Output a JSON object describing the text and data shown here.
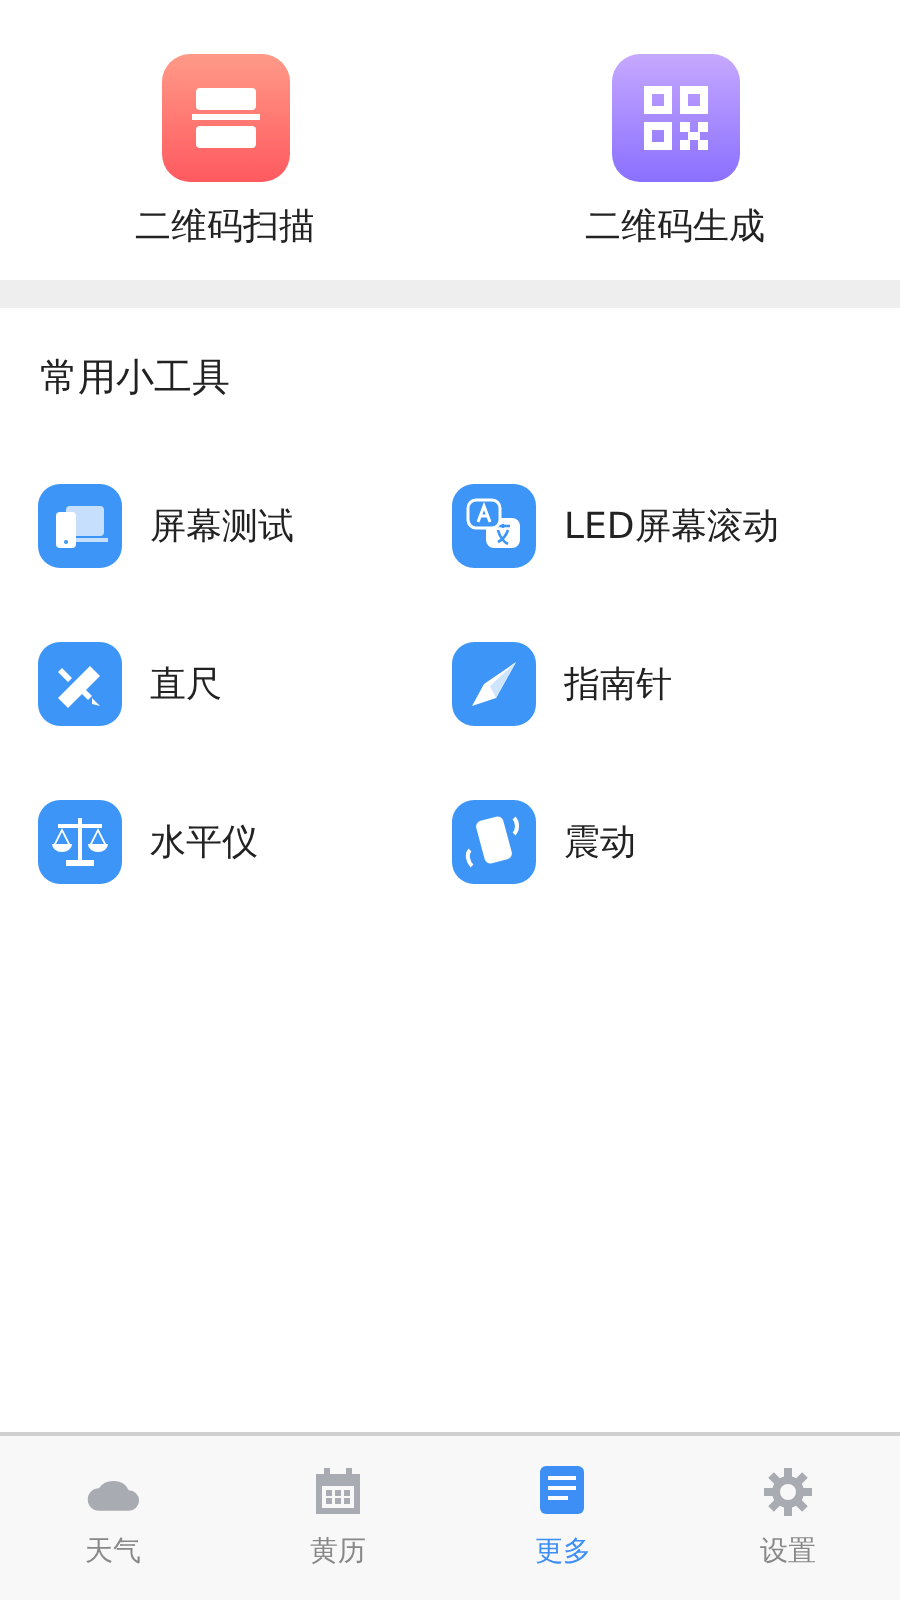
{
  "top_tools": [
    {
      "label": "二维码扫描",
      "kind": "scan"
    },
    {
      "label": "二维码生成",
      "kind": "qr"
    }
  ],
  "section_title": "常用小工具",
  "tools": [
    {
      "label": "屏幕测试",
      "kind": "devices"
    },
    {
      "label": "LED屏幕滚动",
      "kind": "translate"
    },
    {
      "label": "直尺",
      "kind": "ruler"
    },
    {
      "label": "指南针",
      "kind": "compass"
    },
    {
      "label": "水平仪",
      "kind": "scale"
    },
    {
      "label": "震动",
      "kind": "vibrate"
    }
  ],
  "tab_bar": [
    {
      "label": "天气",
      "kind": "cloud",
      "selected": false
    },
    {
      "label": "黄历",
      "kind": "calendar",
      "selected": false
    },
    {
      "label": "更多",
      "kind": "list",
      "selected": true
    },
    {
      "label": "设置",
      "kind": "gear",
      "selected": false
    }
  ]
}
